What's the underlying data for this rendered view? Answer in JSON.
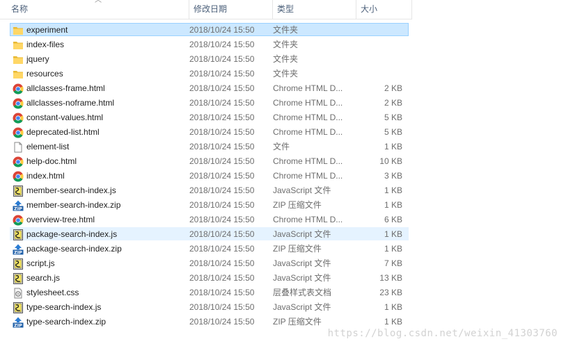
{
  "columns": {
    "name": "名称",
    "date": "修改日期",
    "type": "类型",
    "size": "大小"
  },
  "colors": {
    "selection_bg": "#cce8ff",
    "selection_border": "#99d1ff",
    "hover_bg": "#e5f3ff",
    "folder": "#ffd766"
  },
  "files": [
    {
      "name": "experiment",
      "date": "2018/10/24 15:50",
      "type": "文件夹",
      "size": "",
      "icon": "folder-icon",
      "state": "selected"
    },
    {
      "name": "index-files",
      "date": "2018/10/24 15:50",
      "type": "文件夹",
      "size": "",
      "icon": "folder-icon",
      "state": ""
    },
    {
      "name": "jquery",
      "date": "2018/10/24 15:50",
      "type": "文件夹",
      "size": "",
      "icon": "folder-icon",
      "state": ""
    },
    {
      "name": "resources",
      "date": "2018/10/24 15:50",
      "type": "文件夹",
      "size": "",
      "icon": "folder-icon",
      "state": ""
    },
    {
      "name": "allclasses-frame.html",
      "date": "2018/10/24 15:50",
      "type": "Chrome HTML D...",
      "size": "2 KB",
      "icon": "chrome-icon",
      "state": ""
    },
    {
      "name": "allclasses-noframe.html",
      "date": "2018/10/24 15:50",
      "type": "Chrome HTML D...",
      "size": "2 KB",
      "icon": "chrome-icon",
      "state": ""
    },
    {
      "name": "constant-values.html",
      "date": "2018/10/24 15:50",
      "type": "Chrome HTML D...",
      "size": "5 KB",
      "icon": "chrome-icon",
      "state": ""
    },
    {
      "name": "deprecated-list.html",
      "date": "2018/10/24 15:50",
      "type": "Chrome HTML D...",
      "size": "5 KB",
      "icon": "chrome-icon",
      "state": ""
    },
    {
      "name": "element-list",
      "date": "2018/10/24 15:50",
      "type": "文件",
      "size": "1 KB",
      "icon": "blank-file-icon",
      "state": ""
    },
    {
      "name": "help-doc.html",
      "date": "2018/10/24 15:50",
      "type": "Chrome HTML D...",
      "size": "10 KB",
      "icon": "chrome-icon",
      "state": ""
    },
    {
      "name": "index.html",
      "date": "2018/10/24 15:50",
      "type": "Chrome HTML D...",
      "size": "3 KB",
      "icon": "chrome-icon",
      "state": ""
    },
    {
      "name": "member-search-index.js",
      "date": "2018/10/24 15:50",
      "type": "JavaScript 文件",
      "size": "1 KB",
      "icon": "js-file-icon",
      "state": ""
    },
    {
      "name": "member-search-index.zip",
      "date": "2018/10/24 15:50",
      "type": "ZIP 压缩文件",
      "size": "1 KB",
      "icon": "zip-icon",
      "state": ""
    },
    {
      "name": "overview-tree.html",
      "date": "2018/10/24 15:50",
      "type": "Chrome HTML D...",
      "size": "6 KB",
      "icon": "chrome-icon",
      "state": ""
    },
    {
      "name": "package-search-index.js",
      "date": "2018/10/24 15:50",
      "type": "JavaScript 文件",
      "size": "1 KB",
      "icon": "js-file-icon",
      "state": "hover"
    },
    {
      "name": "package-search-index.zip",
      "date": "2018/10/24 15:50",
      "type": "ZIP 压缩文件",
      "size": "1 KB",
      "icon": "zip-icon",
      "state": ""
    },
    {
      "name": "script.js",
      "date": "2018/10/24 15:50",
      "type": "JavaScript 文件",
      "size": "7 KB",
      "icon": "js-file-icon",
      "state": ""
    },
    {
      "name": "search.js",
      "date": "2018/10/24 15:50",
      "type": "JavaScript 文件",
      "size": "13 KB",
      "icon": "js-file-icon",
      "state": ""
    },
    {
      "name": "stylesheet.css",
      "date": "2018/10/24 15:50",
      "type": "层叠样式表文档",
      "size": "23 KB",
      "icon": "css-file-icon",
      "state": ""
    },
    {
      "name": "type-search-index.js",
      "date": "2018/10/24 15:50",
      "type": "JavaScript 文件",
      "size": "1 KB",
      "icon": "js-file-icon",
      "state": ""
    },
    {
      "name": "type-search-index.zip",
      "date": "2018/10/24 15:50",
      "type": "ZIP 压缩文件",
      "size": "1 KB",
      "icon": "zip-icon",
      "state": ""
    }
  ],
  "watermark": "https://blog.csdn.net/weixin_41303760"
}
